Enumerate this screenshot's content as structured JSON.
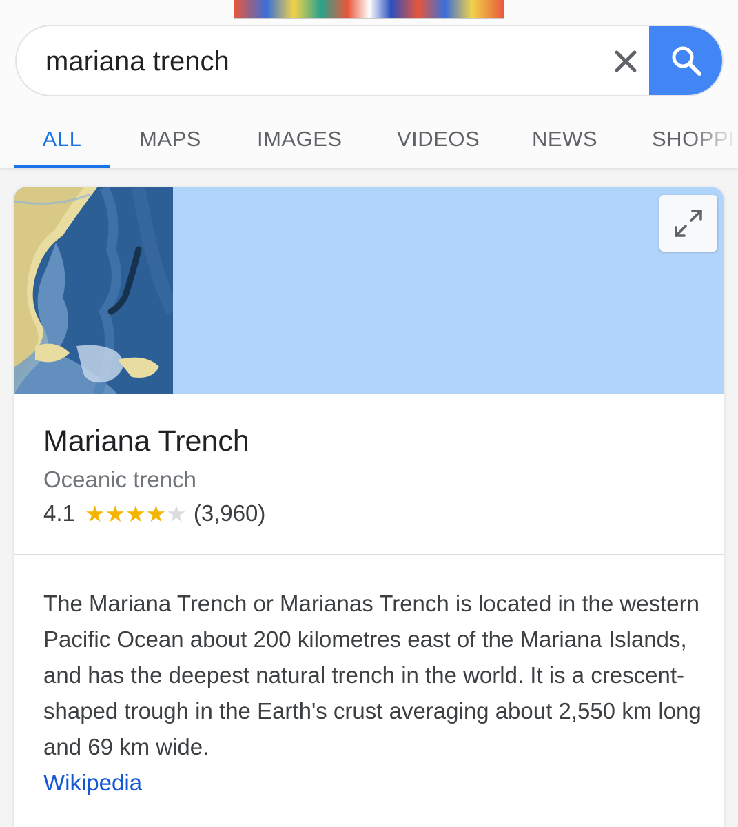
{
  "search": {
    "query": "mariana trench",
    "clear_icon": "close-icon",
    "search_icon": "search-icon",
    "accent": "#4285f4"
  },
  "tabs": [
    {
      "label": "ALL",
      "active": true
    },
    {
      "label": "MAPS",
      "active": false
    },
    {
      "label": "IMAGES",
      "active": false
    },
    {
      "label": "VIDEOS",
      "active": false
    },
    {
      "label": "NEWS",
      "active": false
    },
    {
      "label": "SHOPPI",
      "active": false
    }
  ],
  "card": {
    "map_color": "#b1d4fb",
    "expand_icon": "expand-icon",
    "title": "Mariana Trench",
    "subtitle": "Oceanic trench",
    "rating": "4.1",
    "rating_fraction": 0.82,
    "rating_count": "(3,960)",
    "description": "The Mariana Trench or Marianas Trench is located in the western Pacific Ocean about 200 kilometres east of the Mariana Islands, and has the deepest natural trench in the world. It is a crescent-shaped trough in the Earth's crust averaging about 2,550 km long and 69 km wide.",
    "source_link": "Wikipedia"
  }
}
